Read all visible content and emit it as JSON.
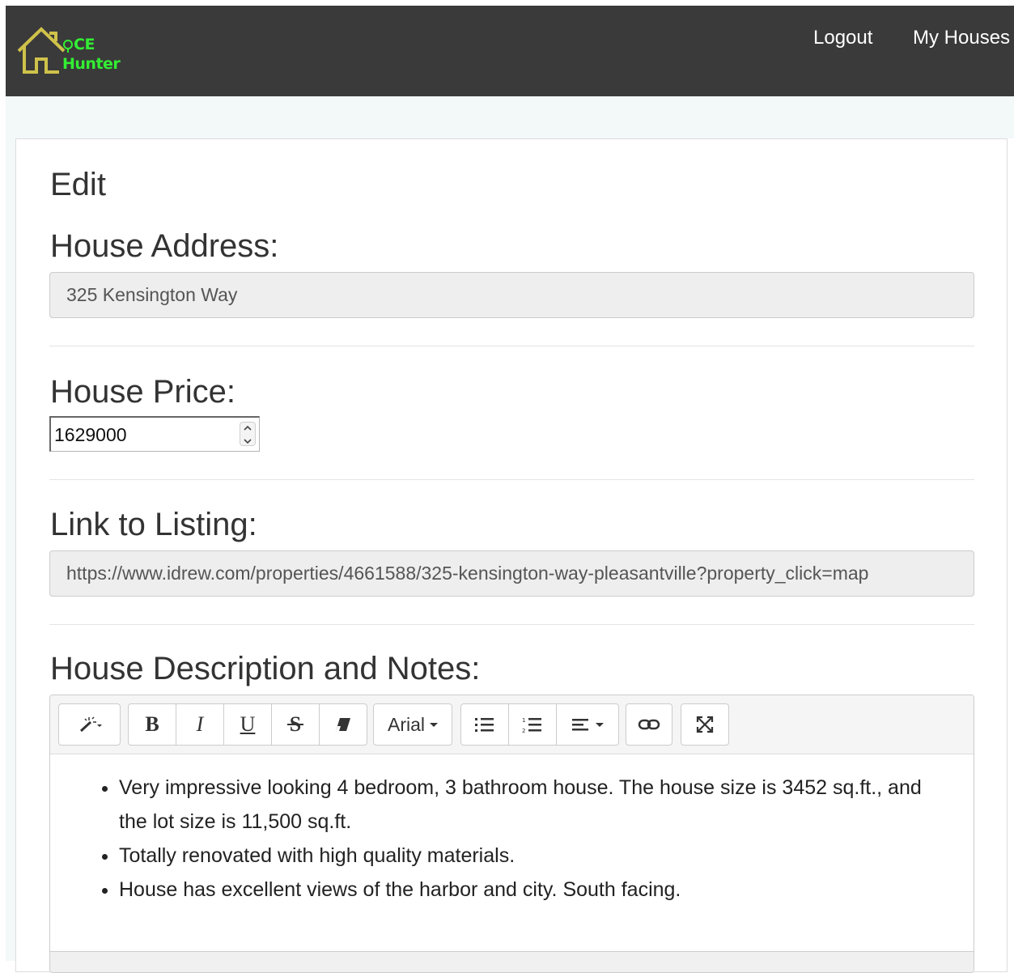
{
  "brand": {
    "line1": "CE",
    "line2": "Hunter",
    "accent_color": "#33ee33"
  },
  "nav": {
    "logout": "Logout",
    "my_houses": "My Houses"
  },
  "page": {
    "title": "Edit"
  },
  "form": {
    "address": {
      "label": "House Address:",
      "value": "325 Kensington Way"
    },
    "price": {
      "label": "House Price:",
      "value": "1629000"
    },
    "listing": {
      "label": "Link to Listing:",
      "value": "https://www.idrew.com/properties/4661588/325-kensington-way-pleasantville?property_click=map"
    },
    "description": {
      "label": "House Description and Notes:",
      "toolbar": {
        "font_name": "Arial"
      },
      "items": [
        "Very impressive looking 4 bedroom, 3 bathroom house.  The house size is 3452 sq.ft., and the lot size is 11,500 sq.ft.",
        "Totally renovated with high quality materials.",
        "House has excellent views of the harbor and city.  South facing."
      ]
    }
  },
  "icons": {
    "logo": "house-outline-icon",
    "style": "magic-wand-icon",
    "bold": "bold-icon",
    "italic": "italic-icon",
    "underline": "underline-icon",
    "strikethrough": "strikethrough-icon",
    "eraser": "eraser-icon",
    "ul": "unordered-list-icon",
    "ol": "ordered-list-icon",
    "align": "align-icon",
    "link": "link-icon",
    "fullscreen": "fullscreen-icon"
  }
}
